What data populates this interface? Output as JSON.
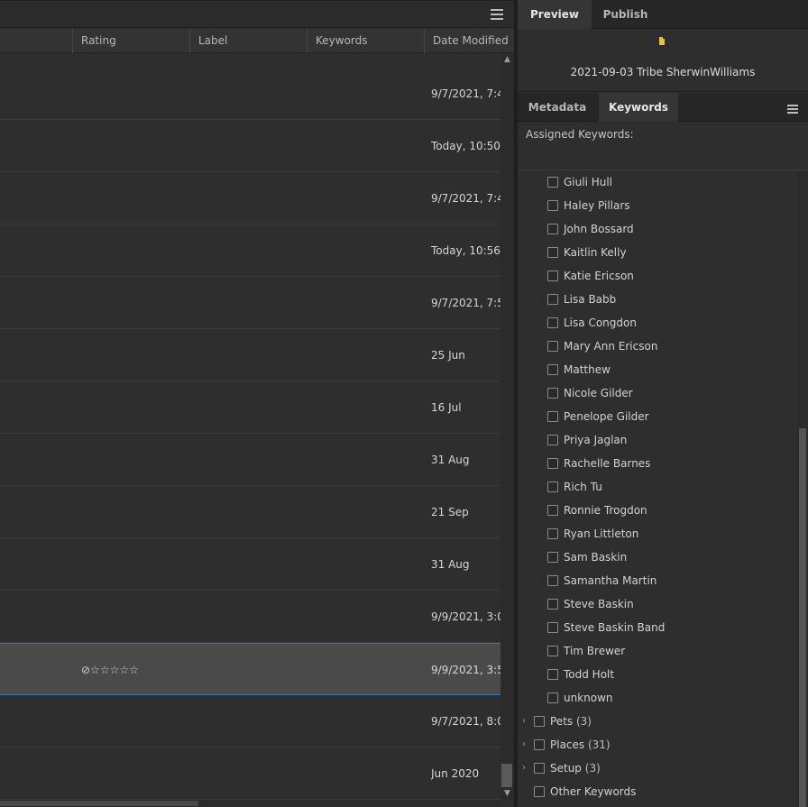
{
  "columns": [
    "Rating",
    "Label",
    "Keywords",
    "Date Modified"
  ],
  "rows": [
    {
      "date": "9/7/2021, 7:4",
      "rating": ""
    },
    {
      "date": "Today, 10:50",
      "rating": ""
    },
    {
      "date": "9/7/2021, 7:4",
      "rating": ""
    },
    {
      "date": "Today, 10:56",
      "rating": ""
    },
    {
      "date": "9/7/2021, 7:5",
      "rating": ""
    },
    {
      "date": "25 Jun",
      "rating": ""
    },
    {
      "date": "16 Jul",
      "rating": ""
    },
    {
      "date": "31 Aug",
      "rating": ""
    },
    {
      "date": "21 Sep",
      "rating": ""
    },
    {
      "date": "31 Aug",
      "rating": ""
    },
    {
      "date": "9/9/2021, 3:0",
      "rating": ""
    },
    {
      "date": "9/9/2021, 3:5",
      "rating": "⊘☆☆☆☆☆",
      "selected": true
    },
    {
      "date": "9/7/2021, 8:0",
      "rating": ""
    },
    {
      "date": "Jun 2020",
      "rating": ""
    }
  ],
  "right_panel": {
    "top_tabs": [
      "Preview",
      "Publish"
    ],
    "preview_title": "2021-09-03 Tribe SherwinWilliams",
    "lower_tabs": [
      "Metadata",
      "Keywords"
    ],
    "assigned_label": "Assigned Keywords:",
    "keywords": [
      "Giuli Hull",
      "Haley Pillars",
      "John Bossard",
      "Kaitlin Kelly",
      "Katie Ericson",
      "Lisa Babb",
      "Lisa Congdon",
      "Mary Ann Ericson",
      "Matthew",
      "Nicole Gilder",
      "Penelope Gilder",
      "Priya Jaglan",
      "Rachelle Barnes",
      "Rich Tu",
      "Ronnie Trogdon",
      "Ryan Littleton",
      "Sam Baskin",
      "Samantha Martin",
      "Steve Baskin",
      "Steve Baskin Band",
      "Tim Brewer",
      "Todd Holt",
      "unknown"
    ],
    "categories": [
      {
        "name": "Pets",
        "count": "(3)",
        "expandable": true
      },
      {
        "name": "Places",
        "count": "(31)",
        "expandable": true
      },
      {
        "name": "Setup",
        "count": "(3)",
        "expandable": true
      },
      {
        "name": "Other Keywords",
        "count": "",
        "expandable": false
      }
    ]
  },
  "colors": {
    "accent": "#3b74b8",
    "thumbnail": "#e9c23a"
  }
}
